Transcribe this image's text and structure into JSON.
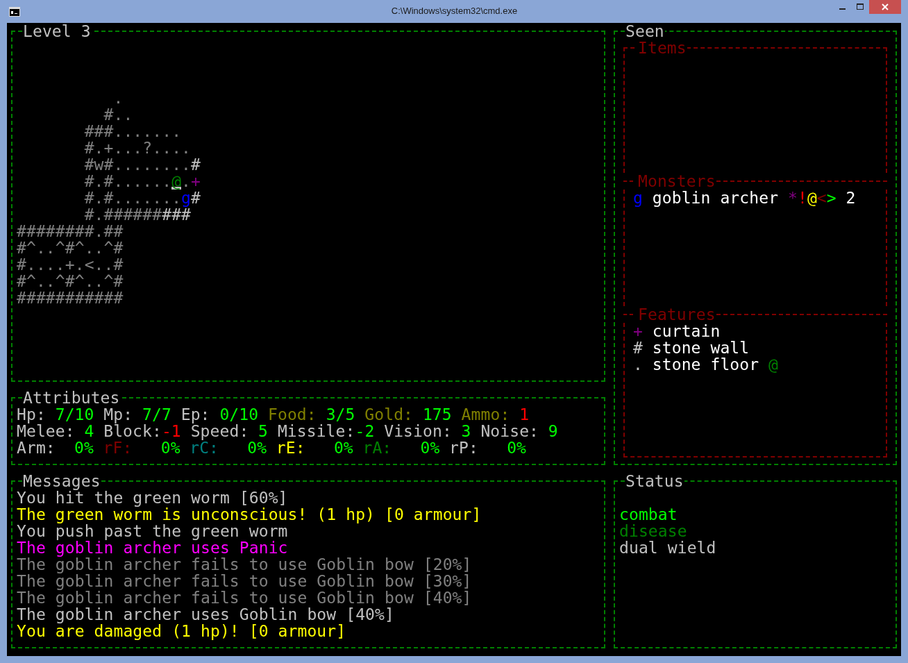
{
  "window": {
    "title": "C:\\Windows\\system32\\cmd.exe"
  },
  "map": {
    "title": "Level 3",
    "rows": [
      {
        "runs": [
          {
            "text": "          .",
            "color": "#808080",
            "cursor": false
          }
        ]
      },
      {
        "runs": [
          {
            "text": "         #..",
            "color": "#808080",
            "cursor": false
          }
        ]
      },
      {
        "runs": [
          {
            "text": "       ###.......",
            "color": "#808080",
            "cursor": false
          }
        ]
      },
      {
        "runs": [
          {
            "text": "       #.+...?....",
            "color": "#808080",
            "cursor": false
          }
        ]
      },
      {
        "runs": [
          {
            "text": "       #w#........",
            "color": "#808080",
            "cursor": false
          },
          {
            "text": "#",
            "color": "#c0c0c0",
            "cursor": false
          }
        ]
      },
      {
        "runs": [
          {
            "text": "       #.#......",
            "color": "#808080",
            "cursor": false
          },
          {
            "text": "@",
            "color": "#008000",
            "cursor": true
          },
          {
            "text": ".",
            "color": "#808080",
            "cursor": false
          },
          {
            "text": "+",
            "color": "#800080",
            "cursor": false
          }
        ]
      },
      {
        "runs": [
          {
            "text": "       #.#.......",
            "color": "#808080",
            "cursor": false
          },
          {
            "text": "g",
            "color": "#0000ff",
            "cursor": false
          },
          {
            "text": "#",
            "color": "#c0c0c0",
            "cursor": false
          }
        ]
      },
      {
        "runs": [
          {
            "text": "       #.######",
            "color": "#808080",
            "cursor": false
          },
          {
            "text": "###",
            "color": "#c0c0c0",
            "cursor": false
          }
        ]
      },
      {
        "runs": [
          {
            "text": "########.##",
            "color": "#808080",
            "cursor": false
          }
        ]
      },
      {
        "runs": [
          {
            "text": "#^..^#^..^#",
            "color": "#808080",
            "cursor": false
          }
        ]
      },
      {
        "runs": [
          {
            "text": "#....+.<..#",
            "color": "#808080",
            "cursor": false
          }
        ]
      },
      {
        "runs": [
          {
            "text": "#^..^#^..^#",
            "color": "#808080",
            "cursor": false
          }
        ]
      },
      {
        "runs": [
          {
            "text": "###########",
            "color": "#808080",
            "cursor": false
          }
        ]
      }
    ]
  },
  "attributes": {
    "title": "Attributes",
    "rows": [
      {
        "kind": "stats",
        "items": [
          {
            "label": {
              "text": "Hp:",
              "color": "#c0c0c0"
            },
            "value": {
              "text": "7/10",
              "color": "#00ff00"
            }
          },
          {
            "label": {
              "text": "Mp:",
              "color": "#c0c0c0"
            },
            "value": {
              "text": "7/7",
              "color": "#00ff00"
            }
          },
          {
            "label": {
              "text": "Ep:",
              "color": "#c0c0c0"
            },
            "value": {
              "text": "0/10",
              "color": "#00ff00"
            }
          },
          {
            "label": {
              "text": "Food:",
              "color": "#808000"
            },
            "value": {
              "text": "3/5",
              "color": "#00ff00"
            }
          },
          {
            "label": {
              "text": "Gold:",
              "color": "#808000"
            },
            "value": {
              "text": "175",
              "color": "#00ff00"
            }
          },
          {
            "label": {
              "text": "Ammo:",
              "color": "#808000"
            },
            "value": {
              "text": "1",
              "color": "#ff0000"
            }
          }
        ]
      },
      {
        "kind": "modifiers",
        "items": [
          {
            "label": {
              "text": "Melee:",
              "color": "#c0c0c0"
            },
            "value": {
              "text": "4",
              "color": "#00ff00"
            }
          },
          {
            "label": {
              "text": "Block:",
              "color": "#c0c0c0"
            },
            "value": {
              "text": "-1",
              "color": "#ff0000"
            }
          },
          {
            "label": {
              "text": "Speed:",
              "color": "#c0c0c0"
            },
            "value": {
              "text": "5",
              "color": "#00ff00"
            }
          },
          {
            "label": {
              "text": "Missile:",
              "color": "#c0c0c0"
            },
            "value": {
              "text": "-2",
              "color": "#00ff00"
            }
          },
          {
            "label": {
              "text": "Vision:",
              "color": "#c0c0c0"
            },
            "value": {
              "text": "3",
              "color": "#00ff00"
            }
          },
          {
            "label": {
              "text": "Noise:",
              "color": "#c0c0c0"
            },
            "value": {
              "text": "9",
              "color": "#00ff00"
            }
          }
        ]
      },
      {
        "kind": "resists",
        "items": [
          {
            "label": {
              "text": "Arm:",
              "color": "#c0c0c0"
            },
            "value": {
              "text": "0%",
              "color": "#00ff00"
            }
          },
          {
            "label": {
              "text": "rF:",
              "color": "#800000"
            },
            "value": {
              "text": "0%",
              "color": "#00ff00"
            }
          },
          {
            "label": {
              "text": "rC:",
              "color": "#008080"
            },
            "value": {
              "text": "0%",
              "color": "#00ff00"
            }
          },
          {
            "label": {
              "text": "rE:",
              "color": "#ffff00"
            },
            "value": {
              "text": "0%",
              "color": "#00ff00"
            }
          },
          {
            "label": {
              "text": "rA:",
              "color": "#008000"
            },
            "value": {
              "text": "0%",
              "color": "#00ff00"
            }
          },
          {
            "label": {
              "text": "rP:",
              "color": "#c0c0c0"
            },
            "value": {
              "text": "0%",
              "color": "#00ff00"
            }
          }
        ]
      }
    ]
  },
  "messages": {
    "title": "Messages",
    "lines": [
      {
        "text": "You hit the green worm [60%]",
        "color": "#c0c0c0"
      },
      {
        "text": "The green worm is unconscious! (1 hp) [0 armour]",
        "color": "#ffff00"
      },
      {
        "text": "You push past the green worm",
        "color": "#c0c0c0"
      },
      {
        "text": "The goblin archer uses Panic",
        "color": "#ff00ff"
      },
      {
        "text": "The goblin archer fails to use Goblin bow [20%]",
        "color": "#808080"
      },
      {
        "text": "The goblin archer fails to use Goblin bow [30%]",
        "color": "#808080"
      },
      {
        "text": "The goblin archer fails to use Goblin bow [40%]",
        "color": "#808080"
      },
      {
        "text": "The goblin archer uses Goblin bow [40%]",
        "color": "#c0c0c0"
      },
      {
        "text": "You are damaged (1 hp)! [0 armour]",
        "color": "#ffff00"
      }
    ]
  },
  "seen": {
    "title": "Seen",
    "items": {
      "title": "Items"
    },
    "monsters": {
      "title": "Monsters",
      "entries": [
        {
          "glyph": {
            "text": "g",
            "color": "#0000ff"
          },
          "name": "goblin archer",
          "flags": [
            {
              "text": "*",
              "color": "#800080"
            },
            {
              "text": "!",
              "color": "#ff0000"
            },
            {
              "text": "@",
              "color": "#ffff00"
            },
            {
              "text": "<",
              "color": "#800000"
            },
            {
              "text": ">",
              "color": "#00ff00"
            }
          ],
          "count": "2"
        }
      ]
    },
    "features": {
      "title": "Features",
      "entries": [
        {
          "glyph": {
            "text": "+",
            "color": "#800080"
          },
          "name": "curtain"
        },
        {
          "glyph": {
            "text": "#",
            "color": "#c0c0c0"
          },
          "name": "stone wall"
        },
        {
          "glyph": {
            "text": ".",
            "color": "#c0c0c0"
          },
          "name": "stone floor",
          "mark": {
            "text": "@",
            "color": "#008000"
          }
        }
      ]
    }
  },
  "status": {
    "title": "Status",
    "lines": [
      {
        "text": "combat",
        "color": "#00ff00"
      },
      {
        "text": "disease",
        "color": "#008000"
      },
      {
        "text": "dual wield",
        "color": "#c0c0c0"
      }
    ]
  }
}
